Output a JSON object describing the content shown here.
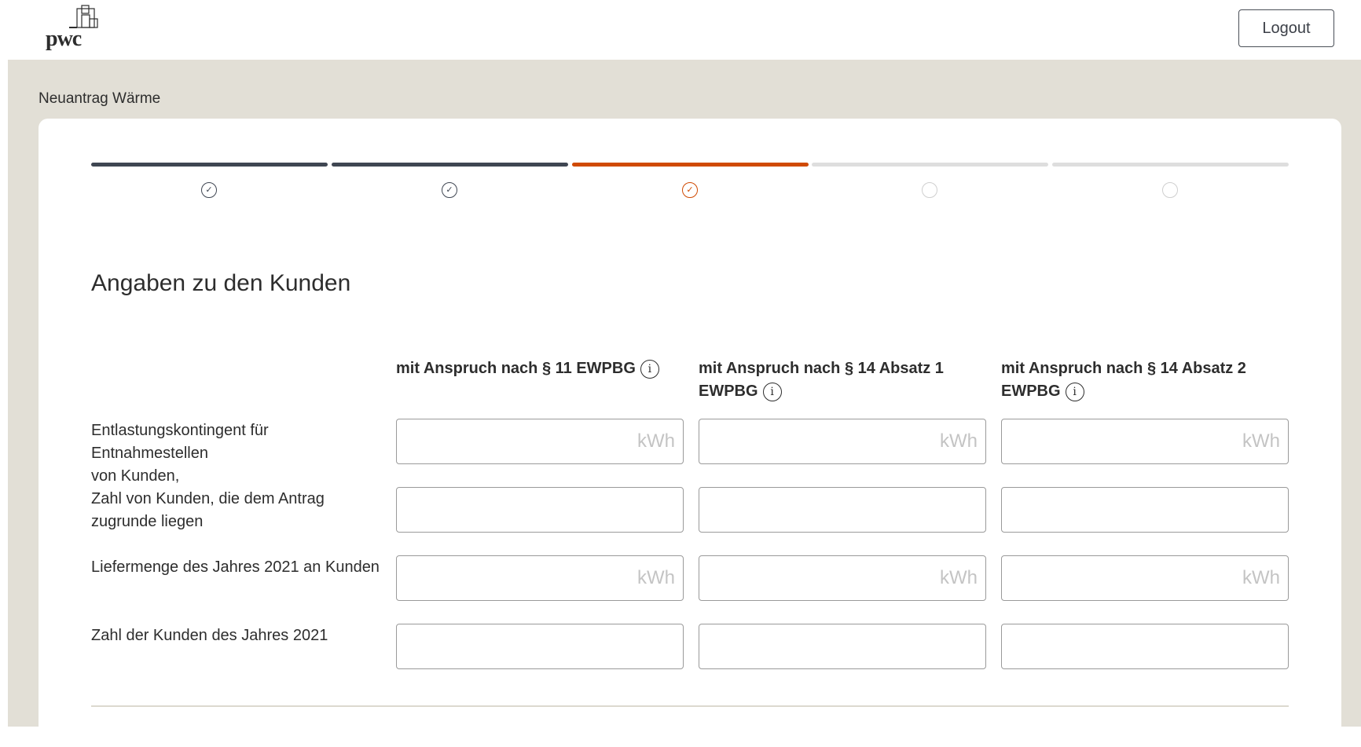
{
  "header": {
    "logo_text": "pwc",
    "logout_label": "Logout"
  },
  "page": {
    "title": "Neuantrag Wärme"
  },
  "stepper": {
    "steps": [
      {
        "state": "complete",
        "symbol": "✓"
      },
      {
        "state": "complete",
        "symbol": "✓"
      },
      {
        "state": "current",
        "symbol": "✓"
      },
      {
        "state": "pending",
        "symbol": ""
      },
      {
        "state": "pending",
        "symbol": ""
      }
    ],
    "colors": {
      "complete": "#3f4652",
      "current": "#d04a02",
      "pending": "#dedede"
    }
  },
  "form": {
    "heading": "Angaben zu den Kunden",
    "columns": [
      {
        "label_line1": "mit Anspruch nach § 11 EWPBG",
        "label_line2": ""
      },
      {
        "label_line1": "mit Anspruch nach § 14 Absatz 1",
        "label_line2": "EWPBG"
      },
      {
        "label_line1": "mit Anspruch nach § 14 Absatz 2",
        "label_line2": "EWPBG"
      }
    ],
    "info_symbol": "i",
    "rows": [
      {
        "label_line1": "Entlastungskontingent für Entnahmestellen",
        "label_line2": "von Kunden,",
        "unit": "kWh"
      },
      {
        "label_line1": "Zahl von Kunden, die dem Antrag",
        "label_line2": "zugrunde liegen",
        "unit": ""
      },
      {
        "label_line1": "Liefermenge des Jahres 2021 an Kunden",
        "label_line2": "",
        "unit": "kWh"
      },
      {
        "label_line1": "Zahl der Kunden des Jahres 2021",
        "label_line2": "",
        "unit": ""
      }
    ]
  }
}
